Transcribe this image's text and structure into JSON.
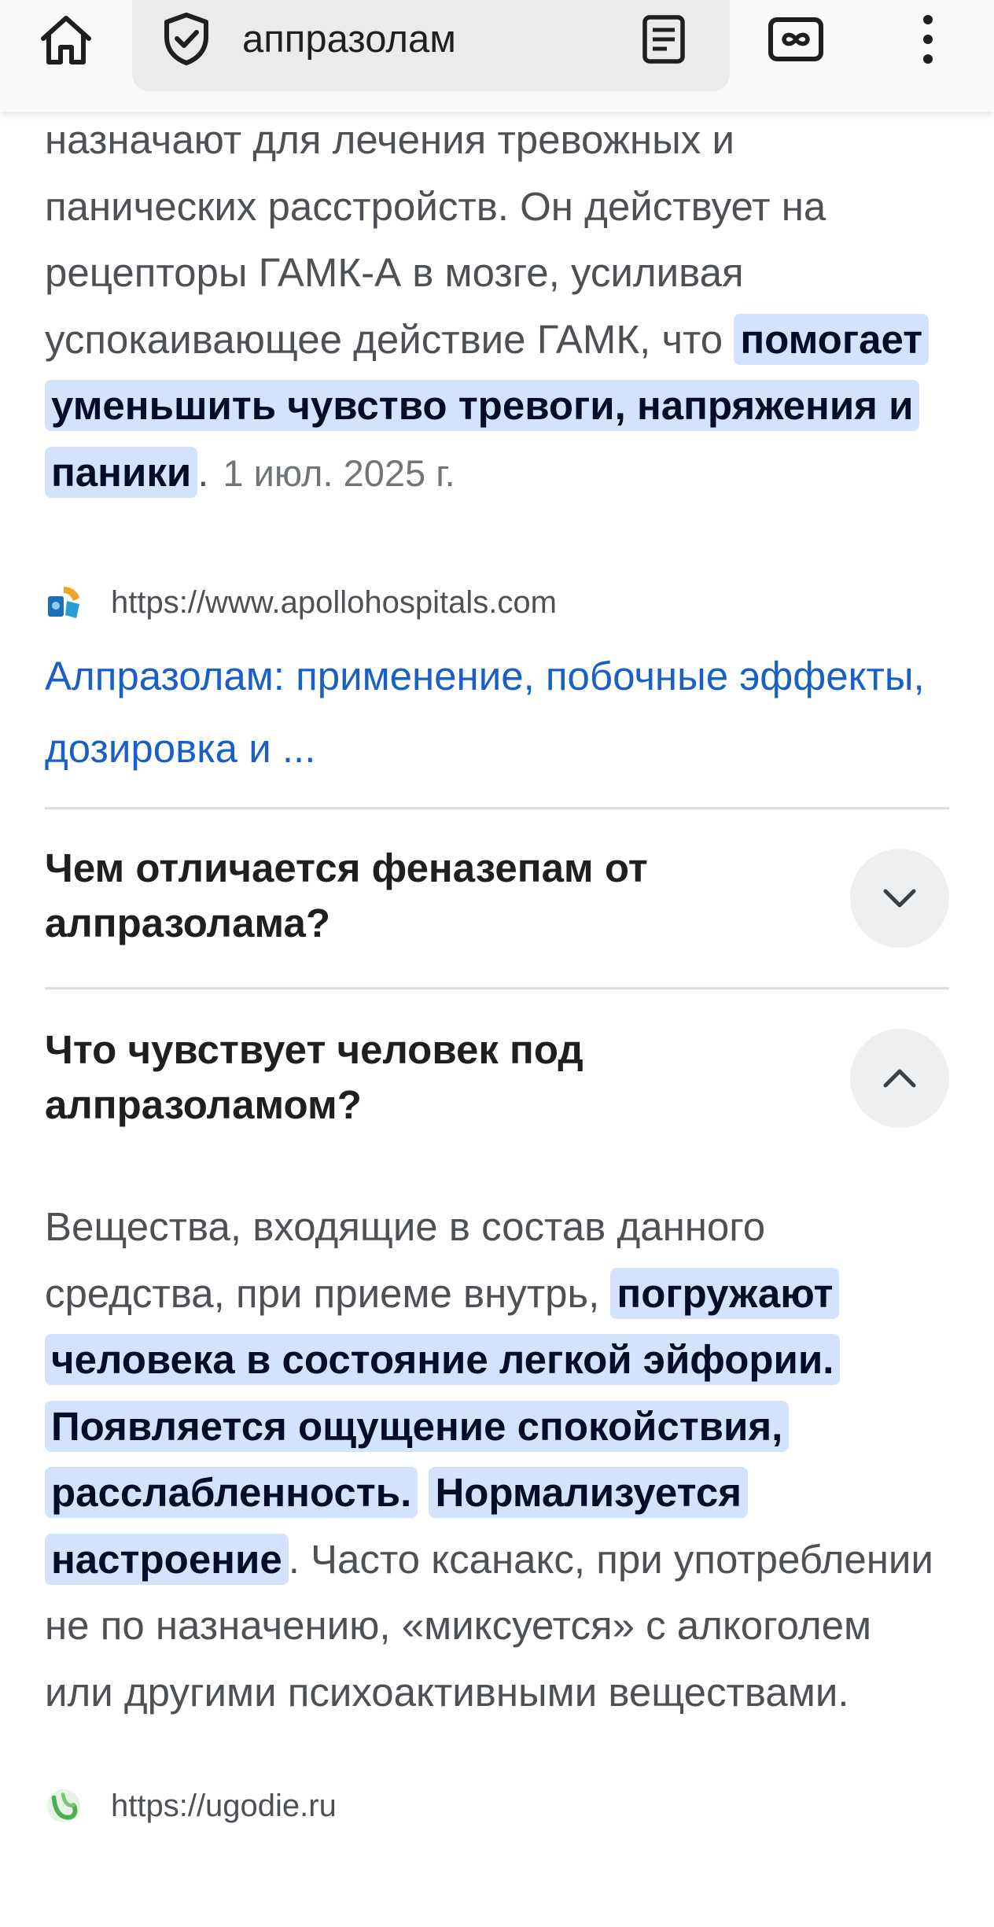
{
  "toolbar": {
    "home_icon": "home-icon",
    "search_query": "аппразолам",
    "security_icon": "shield-check-icon",
    "reader_icon": "reader-mode-icon",
    "tabs_icon": "incognito-tabs-icon",
    "menu_icon": "more-vert-icon"
  },
  "snippet1": {
    "text_plain": "назначают для лечения тревожных и панических расстройств. Он действует на рецепторы ГАМК-А в мозге, усиливая успокаивающее действие ГАМК, что",
    "highlight": "помогает уменьшить чувство тревоги, напряжения и паники",
    "after": ".",
    "date": "1 июл. 2025 г."
  },
  "source1": {
    "url": "https://www.apollohospitals.com",
    "title": "Алпразолам: применение, побочные эффекты, дозировка и ..."
  },
  "faq": [
    {
      "question": "Чем отличается феназепам от алпразолама?",
      "state": "collapsed"
    },
    {
      "question": "Что чувствует человек под алпразоламом?",
      "state": "expanded"
    }
  ],
  "answer2": {
    "lead": "Вещества, входящие в состав данного средства, при приеме внутрь,",
    "highlight1": "погружают человека в состояние легкой эйфории.",
    "highlight2": "Появляется ощущение спокойствия, расслабленность.",
    "highlight3": "Нормализуется настроение",
    "tail": ". Часто ксанакс, при употреблении не по назначению, «миксуется» с алкоголем или другими психоактивными веществами."
  },
  "source2": {
    "url": "https://ugodie.ru"
  },
  "colors": {
    "highlight_bg": "#d3e3fd",
    "link": "#1a5fc8",
    "body_text": "#4d5156"
  }
}
